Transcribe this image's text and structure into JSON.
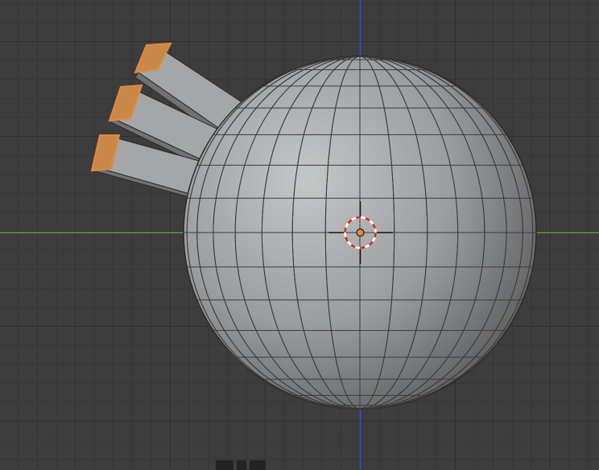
{
  "viewport": {
    "view": "3D Viewport",
    "colors": {
      "background": "#3d3d3d",
      "grid_major": "#2f2f2f",
      "x_axis": "#6f9a2c",
      "y_axis": "#2f5bb5",
      "mesh": "#a9abad",
      "selection": "#e08b3a",
      "cursor_red": "#e02020"
    }
  },
  "scene": {
    "sphere": {
      "segments": 32,
      "rings": 16
    },
    "extrusions": 3,
    "cursor": "3d-cursor",
    "origin": "object-origin"
  }
}
